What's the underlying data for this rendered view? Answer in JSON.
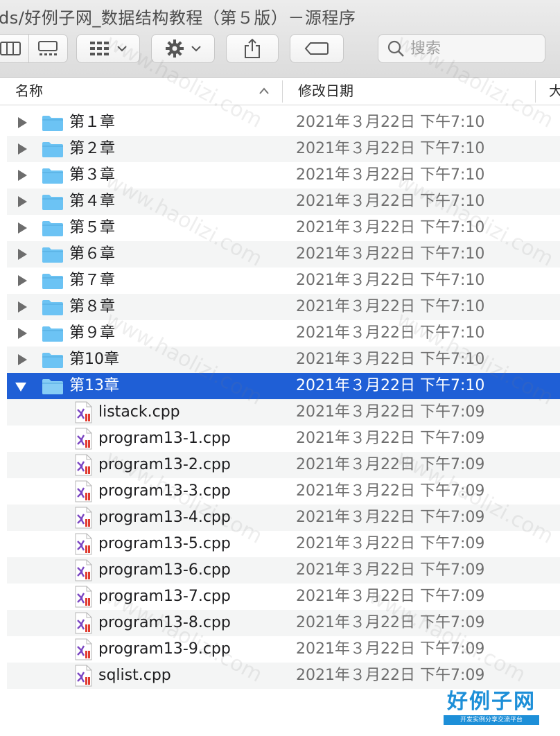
{
  "window": {
    "title": "ds/好例子网_数据结构教程（第５版）－源程序"
  },
  "toolbar": {
    "view_buttons": [
      "column-view",
      "gallery-view"
    ],
    "group_button": "group-by",
    "action_button": "action",
    "share_button": "share",
    "tag_button": "tags",
    "search_placeholder": "搜索"
  },
  "columns": {
    "name": "名称",
    "date_modified": "修改日期",
    "size_partial": "大"
  },
  "rows": [
    {
      "kind": "folder",
      "name": "第１章",
      "date": "2021年３月22日 下午7:10"
    },
    {
      "kind": "folder",
      "name": "第２章",
      "date": "2021年３月22日 下午7:10"
    },
    {
      "kind": "folder",
      "name": "第３章",
      "date": "2021年３月22日 下午7:10"
    },
    {
      "kind": "folder",
      "name": "第４章",
      "date": "2021年３月22日 下午7:10"
    },
    {
      "kind": "folder",
      "name": "第５章",
      "date": "2021年３月22日 下午7:10"
    },
    {
      "kind": "folder",
      "name": "第６章",
      "date": "2021年３月22日 下午7:10"
    },
    {
      "kind": "folder",
      "name": "第７章",
      "date": "2021年３月22日 下午7:10"
    },
    {
      "kind": "folder",
      "name": "第８章",
      "date": "2021年３月22日 下午7:10"
    },
    {
      "kind": "folder",
      "name": "第９章",
      "date": "2021年３月22日 下午7:10"
    },
    {
      "kind": "folder",
      "name": "第10章",
      "date": "2021年３月22日 下午7:10"
    },
    {
      "kind": "folder",
      "name": "第13章",
      "date": "2021年３月22日 下午7:10",
      "expanded": true,
      "selected": true
    },
    {
      "kind": "file",
      "name": "listack.cpp",
      "date": "2021年３月22日 下午7:09"
    },
    {
      "kind": "file",
      "name": "program13-1.cpp",
      "date": "2021年３月22日 下午7:09"
    },
    {
      "kind": "file",
      "name": "program13-2.cpp",
      "date": "2021年３月22日 下午7:09"
    },
    {
      "kind": "file",
      "name": "program13-3.cpp",
      "date": "2021年３月22日 下午7:09"
    },
    {
      "kind": "file",
      "name": "program13-4.cpp",
      "date": "2021年３月22日 下午7:09"
    },
    {
      "kind": "file",
      "name": "program13-5.cpp",
      "date": "2021年３月22日 下午7:09"
    },
    {
      "kind": "file",
      "name": "program13-6.cpp",
      "date": "2021年３月22日 下午7:09"
    },
    {
      "kind": "file",
      "name": "program13-7.cpp",
      "date": "2021年３月22日 下午7:09"
    },
    {
      "kind": "file",
      "name": "program13-8.cpp",
      "date": "2021年３月22日 下午7:09"
    },
    {
      "kind": "file",
      "name": "program13-9.cpp",
      "date": "2021年３月22日 下午7:09"
    },
    {
      "kind": "file",
      "name": "sqlist.cpp",
      "date": "2021年３月22日 下午7:09"
    }
  ],
  "colors": {
    "selection": "#1f5fd6",
    "folder": "#6cc3f3",
    "alt_row": "#f4f5f5"
  },
  "watermark": {
    "text": "www.haolizi.com",
    "brand_title": "好例子网",
    "brand_subtitle": "开发实例分享交流平台"
  }
}
